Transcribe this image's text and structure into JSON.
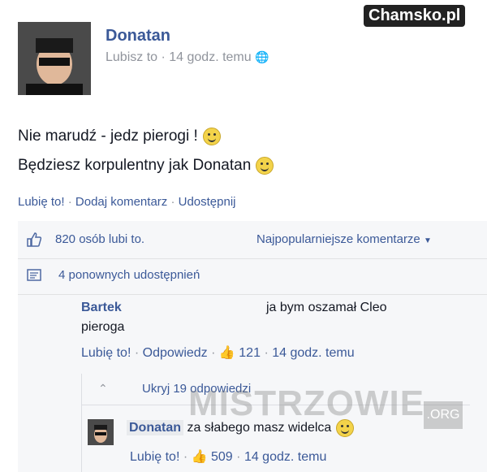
{
  "logo": {
    "text": "Chamsko.pl"
  },
  "post": {
    "author": "Donatan",
    "meta": "Lubisz to · 14 godz. temu",
    "line1": "Nie marudź - jedz pierogi !",
    "line2": "Będziesz korpulentny jak Donatan"
  },
  "actions": {
    "like": "Lubię to!",
    "comment": "Dodaj komentarz",
    "share": "Udostępnij"
  },
  "stats": {
    "likes": "820 osób lubi to.",
    "sort": "Najpopularniejsze komentarze",
    "shares": "4 ponownych udostępnień"
  },
  "comment1": {
    "author": "Bartek",
    "text_a": "ja bym oszamał Cleo",
    "text_b": "pieroga",
    "like": "Lubię to!",
    "reply": "Odpowiedz",
    "count": "121",
    "time": "14 godz. temu"
  },
  "replies": {
    "toggle": "Ukryj 19 odpowiedzi"
  },
  "reply1": {
    "author": "Donatan",
    "text": "za słabego masz widelca",
    "like": "Lubię to!",
    "count": "509",
    "time": "14 godz. temu"
  },
  "watermark": {
    "text": "MISTRZOWIE",
    "badge": ".ORG"
  }
}
